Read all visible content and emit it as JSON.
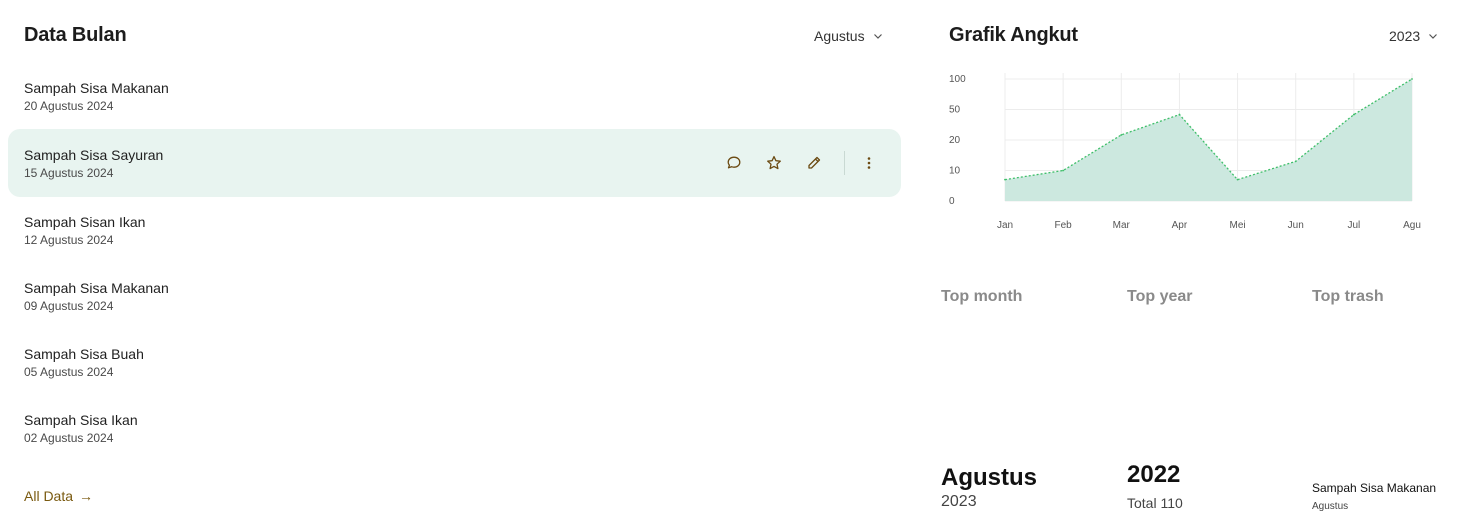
{
  "left_panel": {
    "title": "Data Bulan",
    "month_select": "Agustus",
    "items": [
      {
        "name": "Sampah Sisa Makanan",
        "date": "20 Agustus 2024"
      },
      {
        "name": "Sampah Sisa Sayuran",
        "date": "15 Agustus 2024"
      },
      {
        "name": "Sampah Sisan Ikan",
        "date": "12 Agustus 2024"
      },
      {
        "name": "Sampah Sisa Makanan",
        "date": "09 Agustus 2024"
      },
      {
        "name": "Sampah Sisa Buah",
        "date": "05 Agustus 2024"
      },
      {
        "name": "Sampah Sisa Ikan",
        "date": "02 Agustus 2024"
      }
    ],
    "active_index": 1,
    "row_actions": [
      "comment-icon",
      "star-icon",
      "edit-icon",
      "more-vertical-icon"
    ],
    "all_link": "All Data",
    "all_link_arrow": "→"
  },
  "right_panel": {
    "title": "Grafik Angkut",
    "year_select": "2023",
    "stats": {
      "top_month": {
        "label": "Top month",
        "value": "Agustus",
        "sub": "2023"
      },
      "top_year": {
        "label": "Top year",
        "value": "2022",
        "sub": "Total 110"
      },
      "top_trash": {
        "label": "Top trash",
        "value": "Sampah Sisa Makanan",
        "sub": "Agustus"
      }
    }
  },
  "chart_data": {
    "type": "area",
    "categories": [
      "Jan",
      "Feb",
      "Mar",
      "Apr",
      "Mei",
      "Jun",
      "Jul",
      "Agu"
    ],
    "values": [
      7,
      10,
      25,
      45,
      7,
      13,
      45,
      100
    ],
    "y_ticks": [
      "100",
      "50",
      "20",
      "10",
      "0"
    ],
    "y_tick_values": [
      100,
      50,
      20,
      10,
      0
    ],
    "grid": true,
    "colors": {
      "fill": "#cce8df",
      "line": "#3fbf6a",
      "grid": "#ececec"
    }
  },
  "colors": {
    "accent_bg": "#e8f4f0",
    "link": "#7a5a10",
    "icon": "#6b4a12"
  }
}
